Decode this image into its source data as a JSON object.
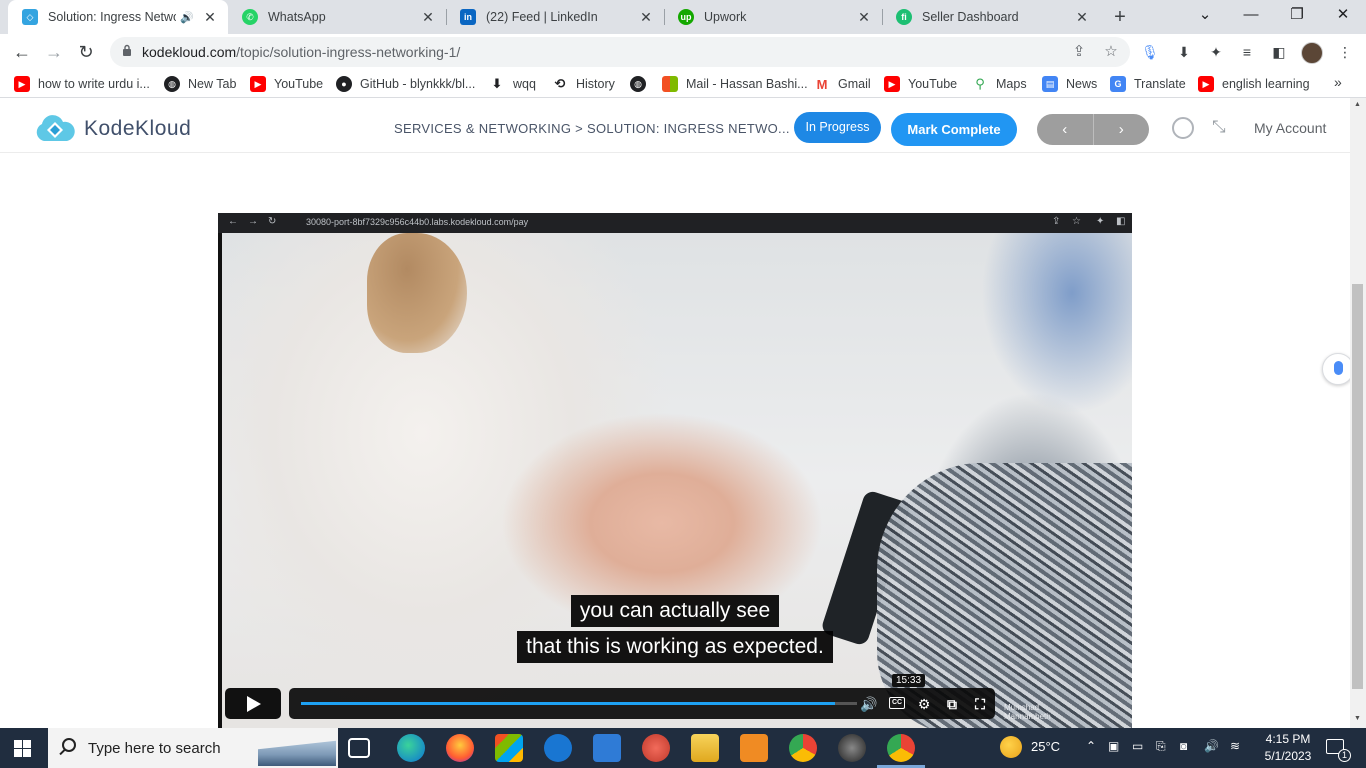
{
  "browser": {
    "tabs": [
      {
        "title": "Solution: Ingress Networ",
        "favicon": "kodekloud-icon",
        "active": true,
        "audio": true
      },
      {
        "title": "WhatsApp",
        "favicon": "whatsapp-icon"
      },
      {
        "title": "(22) Feed | LinkedIn",
        "favicon": "linkedin-icon"
      },
      {
        "title": "Upwork",
        "favicon": "upwork-icon"
      },
      {
        "title": "Seller Dashboard",
        "favicon": "fiverr-icon"
      }
    ],
    "url_host": "kodekloud.com",
    "url_path": "/topic/solution-ingress-networking-1/",
    "bookmarks": [
      {
        "label": "how to write urdu i...",
        "icon": "youtube-icon",
        "color": "#ff0000"
      },
      {
        "label": "New Tab",
        "icon": "globe-icon",
        "color": "#202124"
      },
      {
        "label": "YouTube",
        "icon": "youtube-icon",
        "color": "#ff0000"
      },
      {
        "label": "GitHub - blynkkk/bl...",
        "icon": "github-icon",
        "color": "#202124"
      },
      {
        "label": "wqq",
        "icon": "download-icon",
        "color": "#202124"
      },
      {
        "label": "History",
        "icon": "history-icon",
        "color": "#202124"
      },
      {
        "label": "",
        "icon": "globe-icon",
        "color": "#202124"
      },
      {
        "label": "Mail - Hassan Bashi...",
        "icon": "microsoft-icon",
        "color": "#f25022"
      },
      {
        "label": "Gmail",
        "icon": "gmail-icon",
        "color": "#ea4335"
      },
      {
        "label": "YouTube",
        "icon": "youtube-icon",
        "color": "#ff0000"
      },
      {
        "label": "Maps",
        "icon": "maps-icon",
        "color": "#34a853"
      },
      {
        "label": "News",
        "icon": "news-icon",
        "color": "#4285f4"
      },
      {
        "label": "Translate",
        "icon": "translate-icon",
        "color": "#4285f4"
      },
      {
        "label": "english learning",
        "icon": "youtube-icon",
        "color": "#ff0000"
      }
    ]
  },
  "site": {
    "brand": "KodeKloud",
    "breadcrumb": "SERVICES & NETWORKING > SOLUTION: INGRESS NETWO...",
    "in_progress_label": "In Progress",
    "mark_complete_label": "Mark Complete",
    "prev_label": "‹",
    "next_label": "›",
    "account_label": "My Account",
    "accent_color": "#2196f3"
  },
  "video": {
    "inner_url": "30080-port-8bf7329c956c44b0.labs.kodekloud.com/pay",
    "subtitle_line1": "you can actually see",
    "subtitle_line2": "that this is working as expected.",
    "hover_time": "15:33",
    "progress_fraction": 0.96,
    "watermark_line1": "Mumshad",
    "watermark_line2": "Mannambeth"
  },
  "taskbar": {
    "search_placeholder": "Type here to search",
    "temperature": "25°C",
    "time": "4:15 PM",
    "date": "5/1/2023",
    "notification_count": "1"
  }
}
